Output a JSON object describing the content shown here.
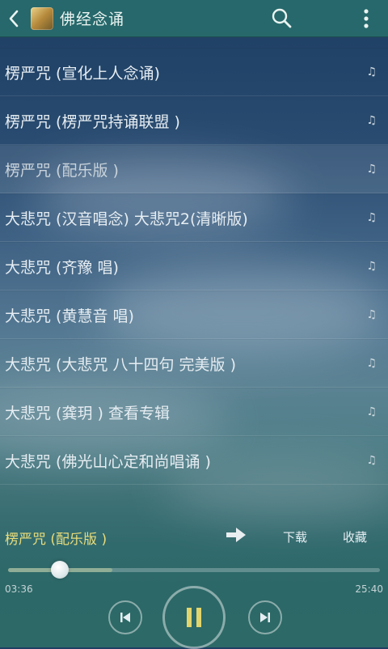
{
  "header": {
    "title": "佛经念诵",
    "back_icon": "back-arrow-icon",
    "search_icon": "search-icon",
    "menu_icon": "more-vertical-icon"
  },
  "songs": [
    {
      "title": "楞严咒 (宣化上人念诵)",
      "active": false
    },
    {
      "title": "楞严咒 (楞严咒持诵联盟 )",
      "active": false
    },
    {
      "title": "楞严咒 (配乐版 )",
      "active": true
    },
    {
      "title": "大悲咒 (汉音唱念) 大悲咒2(清晰版)",
      "active": false
    },
    {
      "title": "大悲咒 (齐豫 唱)",
      "active": false
    },
    {
      "title": "大悲咒 (黄慧音 唱)",
      "active": false
    },
    {
      "title": "大悲咒 (大悲咒 八十四句 完美版 )",
      "active": false
    },
    {
      "title": "大悲咒 (龚玥 ) 查看专辑",
      "active": false
    },
    {
      "title": "大悲咒 (佛光山心定和尚唱诵 )",
      "active": false
    }
  ],
  "note_glyph": "♫",
  "player": {
    "now_playing": "楞严咒 (配乐版 )",
    "download_label": "下载",
    "favorite_label": "收藏",
    "current_time": "03:36",
    "total_time": "25:40",
    "played_fraction": 0.14,
    "buffered_fraction": 0.28
  },
  "colors": {
    "accent_yellow": "#e8dc7a",
    "topbar": "#28706c"
  }
}
